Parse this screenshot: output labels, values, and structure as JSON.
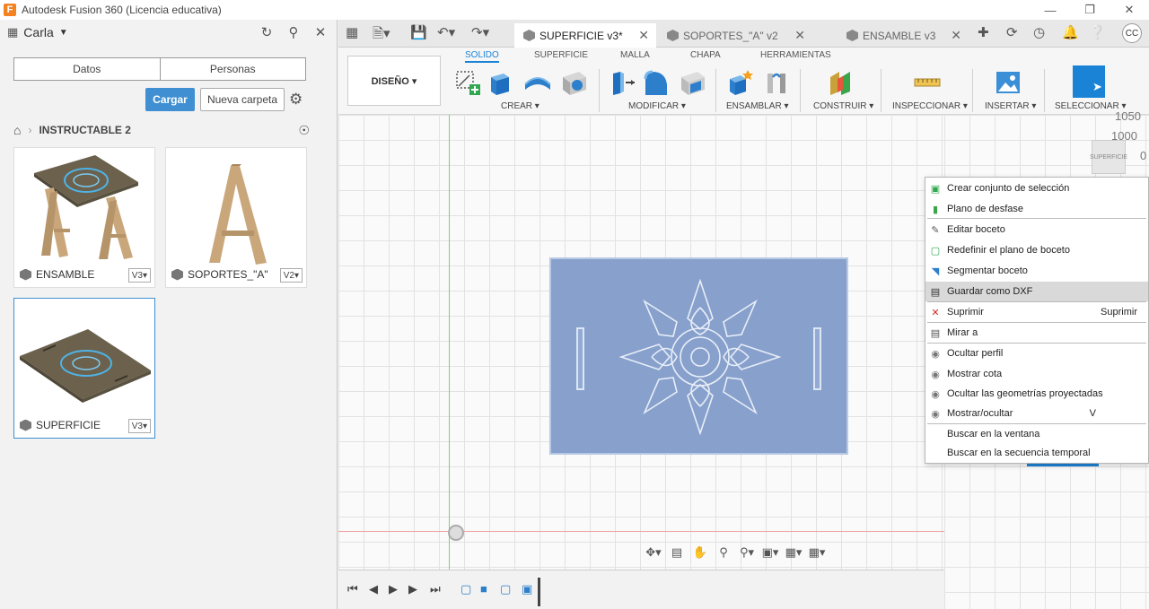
{
  "window": {
    "title": "Autodesk Fusion 360 (Licencia educativa)",
    "logo": "F"
  },
  "datapanel": {
    "user": "Carla",
    "tabs": [
      "Datos",
      "Personas"
    ],
    "upload_label": "Cargar",
    "new_folder_label": "Nueva carpeta",
    "breadcrumb": "INSTRUCTABLE 2",
    "files": [
      {
        "name": "ENSAMBLE",
        "version": "V3▾"
      },
      {
        "name": "SOPORTES_\"A\"",
        "version": "V2▾"
      },
      {
        "name": "SUPERFICIE",
        "version": "V3▾"
      }
    ]
  },
  "doc_tabs": [
    {
      "label": "SUPERFICIE v3*",
      "active": true
    },
    {
      "label": "SOPORTES_\"A\" v2",
      "active": false
    },
    {
      "label": "ENSAMBLE v3",
      "active": false
    }
  ],
  "avatar_initials": "CC",
  "ribbon": {
    "workspace": "DISEÑO ▾",
    "tabs": [
      "SOLIDO",
      "SUPERFICIE",
      "MALLA",
      "CHAPA",
      "HERRAMIENTAS"
    ],
    "groups": [
      "CREAR ▾",
      "MODIFICAR ▾",
      "ENSAMBLAR ▾",
      "CONSTRUIR ▾",
      "INSPECCIONAR ▾",
      "INSERTAR ▾",
      "SELECCIONAR ▾"
    ]
  },
  "viewcube": {
    "labels": [
      "1050",
      "1000",
      "0",
      "SUPERFICIE"
    ]
  },
  "context_menu": {
    "items": [
      {
        "label": "Crear conjunto de selección",
        "shortcut": ""
      },
      {
        "label": "Plano de desfase",
        "shortcut": ""
      },
      {
        "label": "Editar boceto",
        "shortcut": ""
      },
      {
        "label": "Redefinir el plano de boceto",
        "shortcut": ""
      },
      {
        "label": "Segmentar boceto",
        "shortcut": ""
      },
      {
        "label": "Guardar como DXF",
        "shortcut": ""
      },
      {
        "label": "Suprimir",
        "shortcut": "Suprimir"
      },
      {
        "label": "Mirar a",
        "shortcut": ""
      },
      {
        "label": "Ocultar perfil",
        "shortcut": ""
      },
      {
        "label": "Mostrar cota",
        "shortcut": ""
      },
      {
        "label": "Ocultar las geometrías proyectadas",
        "shortcut": ""
      },
      {
        "label": "Mostrar/ocultar",
        "shortcut": "V"
      },
      {
        "label": "Buscar en la ventana",
        "shortcut": ""
      },
      {
        "label": "Buscar en la secuencia temporal",
        "shortcut": ""
      }
    ]
  },
  "colors": {
    "accent": "#3f8fd2",
    "active_tab": "#1b83d6",
    "sketch_fill": "#87a0cc"
  }
}
